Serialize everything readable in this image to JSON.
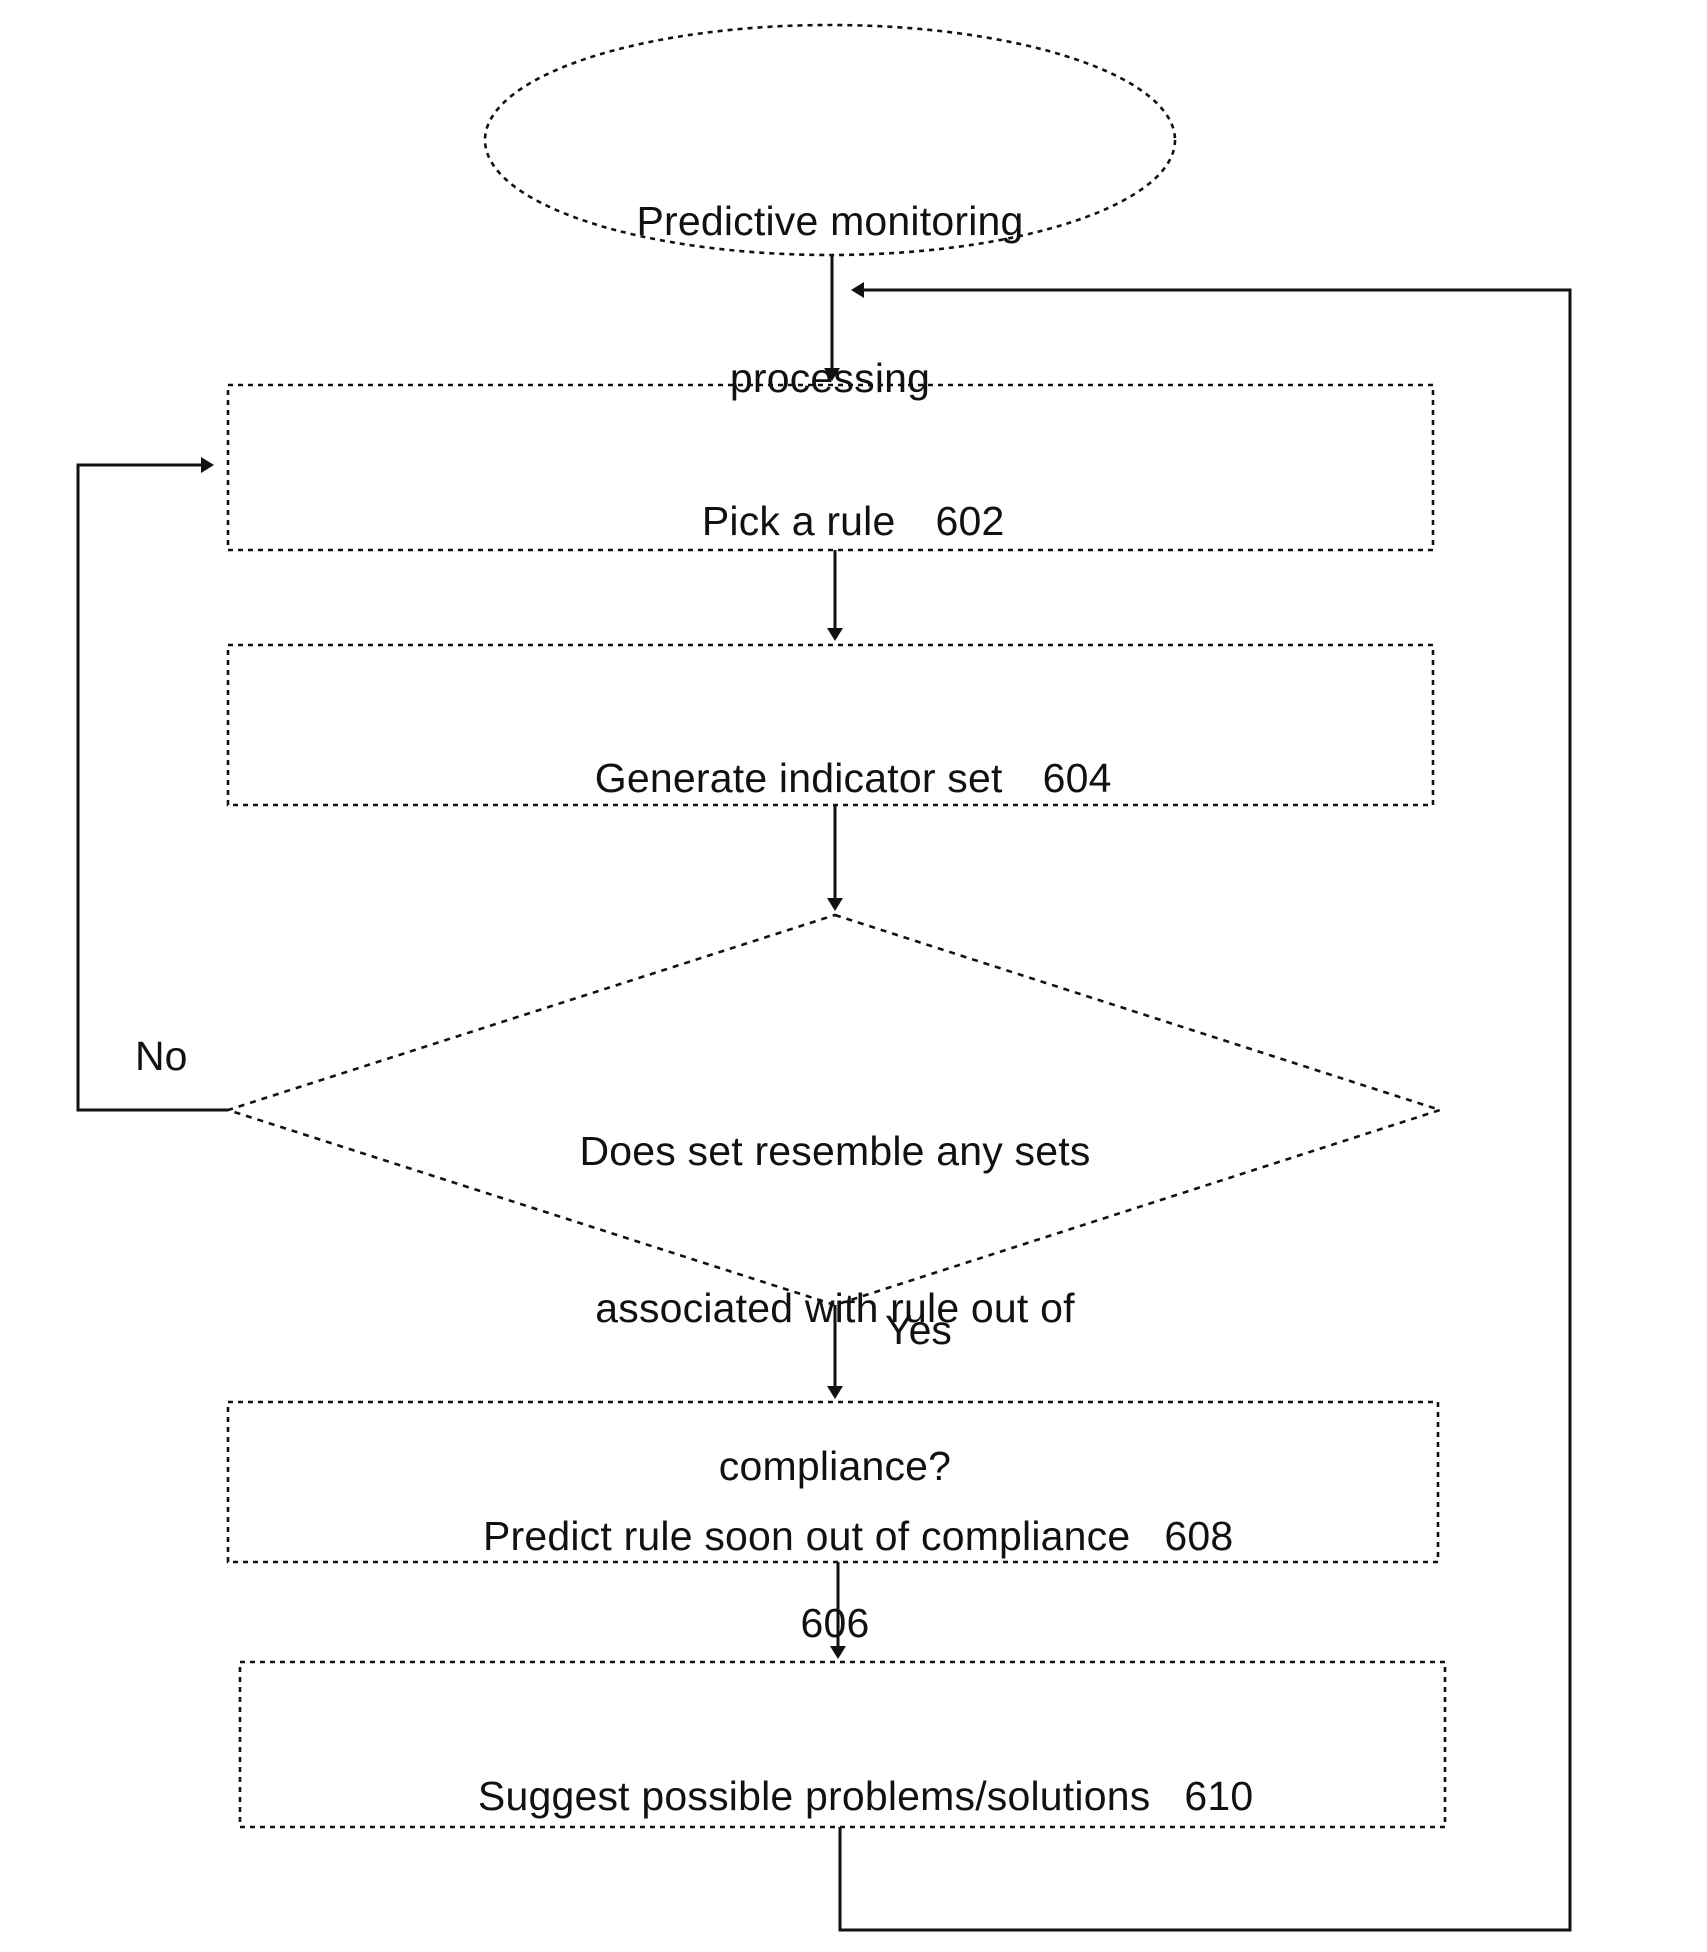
{
  "diagram": {
    "type": "flowchart",
    "title_shape": "terminal-ellipse",
    "line_color": "#111111",
    "background": "#ffffff",
    "nodes": [
      {
        "id": "start",
        "shape": "ellipse",
        "label_line1": "Predictive monitoring",
        "label_line2": "processing",
        "ref": ""
      },
      {
        "id": "step602",
        "shape": "rectangle",
        "label": "Pick a rule",
        "ref": "602"
      },
      {
        "id": "step604",
        "shape": "rectangle",
        "label": "Generate indicator set",
        "ref": "604"
      },
      {
        "id": "decision606",
        "shape": "diamond",
        "label_line1": "Does set resemble any sets",
        "label_line2": "associated with rule out of",
        "label_line3": "compliance?",
        "ref": "606"
      },
      {
        "id": "step608",
        "shape": "rectangle",
        "label": "Predict rule soon out of compliance",
        "ref": "608"
      },
      {
        "id": "step610",
        "shape": "rectangle",
        "label": "Suggest possible problems/solutions",
        "ref": "610"
      }
    ],
    "edges": [
      {
        "id": "e-start-602",
        "from": "start",
        "to": "step602",
        "label": ""
      },
      {
        "id": "e-602-604",
        "from": "step602",
        "to": "step604",
        "label": ""
      },
      {
        "id": "e-604-606",
        "from": "step604",
        "to": "decision606",
        "label": ""
      },
      {
        "id": "e-606-no",
        "from": "decision606",
        "to": "step602",
        "label": "No"
      },
      {
        "id": "e-606-yes",
        "from": "decision606",
        "to": "step608",
        "label": "Yes"
      },
      {
        "id": "e-608-610",
        "from": "step608",
        "to": "step610",
        "label": ""
      },
      {
        "id": "e-610-top",
        "from": "step610",
        "to": "step602",
        "label": ""
      }
    ]
  }
}
